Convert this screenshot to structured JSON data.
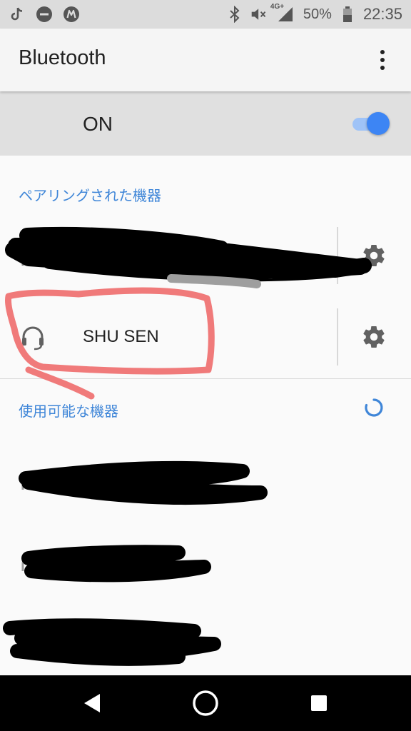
{
  "status_bar": {
    "left_icons": [
      "tiktok-icon",
      "do-not-disturb-icon",
      "m-app-icon"
    ],
    "right_icons": [
      "bluetooth-icon",
      "vibrate-mute-icon",
      "signal-4g-icon",
      "battery-icon"
    ],
    "network": "4G+",
    "battery_percent": "50%",
    "time": "22:35"
  },
  "app_bar": {
    "title": "Bluetooth",
    "more_icon": "more-vert-icon"
  },
  "bluetooth_toggle": {
    "label": "ON",
    "enabled": true,
    "accent_color": "#3d85f4"
  },
  "paired_devices": {
    "header": "ペアリングされた機器",
    "items": [
      {
        "name": "",
        "redacted": true,
        "settings_icon": "gear-icon"
      },
      {
        "name": "SHU SEN",
        "icon": "headset-icon",
        "settings_icon": "gear-icon"
      }
    ]
  },
  "available_devices": {
    "header": "使用可能な機器",
    "loading_icon": "spinner-icon",
    "items": [
      {
        "name": "",
        "redacted": true
      },
      {
        "name": "",
        "redacted": true
      },
      {
        "name": "",
        "redacted": true
      }
    ]
  },
  "nav_bar": {
    "buttons": [
      "back-icon",
      "home-icon",
      "recents-icon"
    ]
  },
  "colors": {
    "accent": "#3f86d8",
    "status_bar_bg": "#dcdcdc",
    "highlight_annotation": "#f07a7a"
  }
}
